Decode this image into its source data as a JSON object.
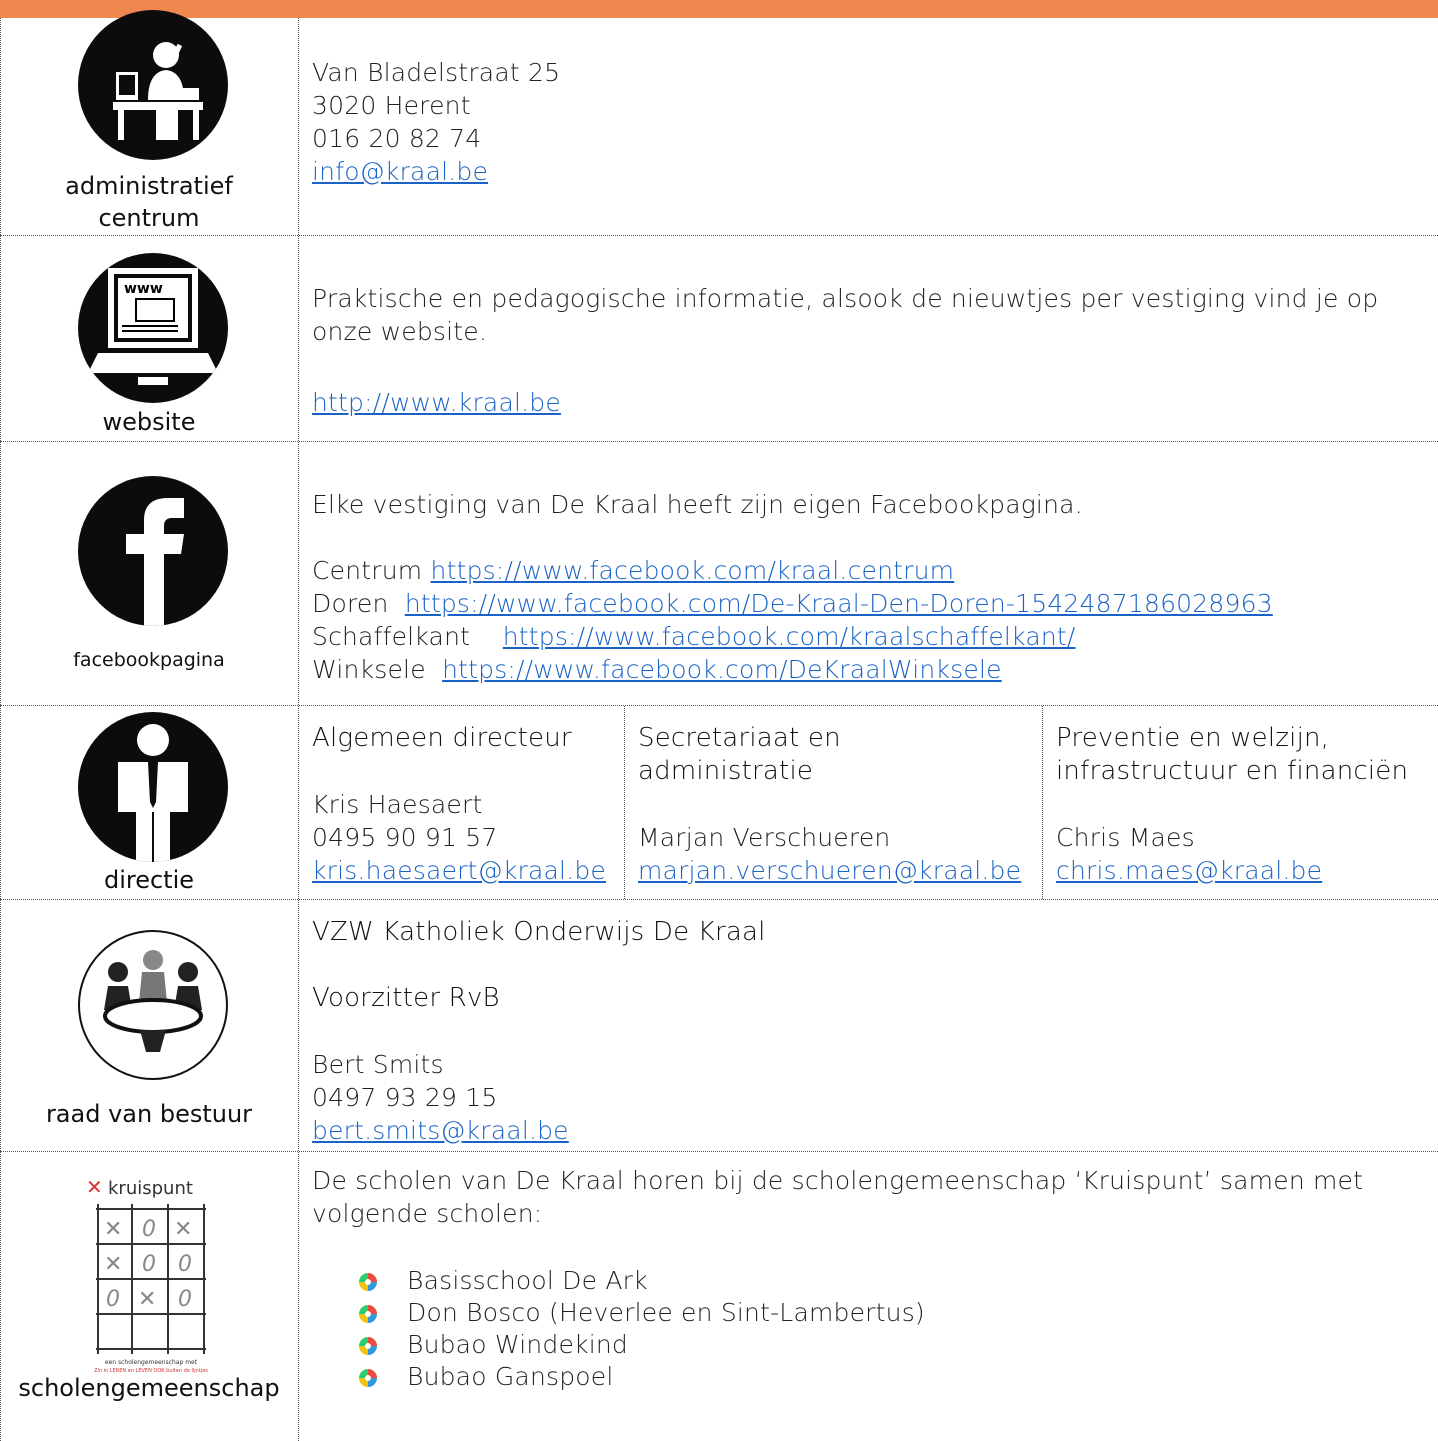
{
  "header_bar": {
    "color": "#f0874e"
  },
  "rows": {
    "admin": {
      "icon": "office-worker-icon",
      "label_line1": "administratief",
      "label_line2": "centrum",
      "address_line1": "Van Bladelstraat 25",
      "address_line2": "3020 Herent",
      "phone": "016 20 82 74",
      "email": "info@kraal.be"
    },
    "website": {
      "icon": "computer-www-icon",
      "label": "website",
      "text_line1": "Praktische en pedagogische informatie, alsook de nieuwtjes per vestiging vind je op",
      "text_line2": "onze website.",
      "url": "http://www.kraal.be"
    },
    "facebook": {
      "icon": "facebook-icon",
      "label": "facebookpagina",
      "intro": "Elke vestiging van De Kraal heeft zijn eigen Facebookpagina.",
      "pages": [
        {
          "name": "Centrum",
          "url": "https://www.facebook.com/kraal.centrum"
        },
        {
          "name": "Doren",
          "url": "https://www.facebook.com/De-Kraal-Den-Doren-1542487186028963"
        },
        {
          "name": "Schaffelkant",
          "url": "https://www.facebook.com/kraalschaffelkant/"
        },
        {
          "name": "Winksele",
          "url": "https://www.facebook.com/DeKraalWinksele"
        }
      ]
    },
    "directie": {
      "icon": "director-person-icon",
      "label": "directie",
      "cols": [
        {
          "title_line1": "Algemeen directeur",
          "title_line2": "",
          "name": "Kris Haesaert",
          "phone": "0495 90 91 57",
          "email": "kris.haesaert@kraal.be"
        },
        {
          "title_line1": "Secretariaat en",
          "title_line2": "administratie",
          "name": "Marjan Verschueren",
          "phone": "",
          "email": "marjan.verschueren@kraal.be"
        },
        {
          "title_line1": "Preventie en welzijn,",
          "title_line2": "infrastructuur en financiën",
          "name": "Chris Maes",
          "phone": "",
          "email": "chris.maes@kraal.be"
        }
      ]
    },
    "raad": {
      "icon": "board-meeting-icon",
      "label": "raad van bestuur",
      "org": "VZW Katholiek Onderwijs De Kraal",
      "role": "Voorzitter RvB",
      "name": "Bert Smits",
      "phone": "0497 93 29 15",
      "email": "bert.smits@kraal.be"
    },
    "scholen": {
      "icon": "kruispunt-logo-icon",
      "logo_title": "kruispunt",
      "logo_caption1": "een scholengemeenschap met",
      "logo_caption2": "Zin in LEREN en LEVEN OOK buiten de lijntjes",
      "label": "scholengemeenschap",
      "text_line1": "De scholen van De Kraal horen bij de scholengemeenschap ‘Kruispunt’ samen met",
      "text_line2": "volgende scholen:",
      "schools": [
        "Basisschool De Ark",
        "Don Bosco (Heverlee en Sint-Lambertus)",
        "Bubao Windekind",
        "Bubao Ganspoel"
      ]
    }
  }
}
